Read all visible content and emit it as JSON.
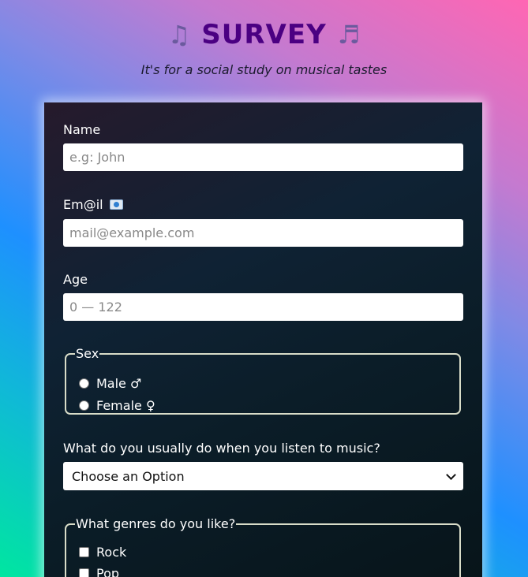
{
  "header": {
    "title": "SURVEY",
    "note_left": "♫",
    "note_right": "♬",
    "subtitle": "It's for a social study on musical tastes"
  },
  "form": {
    "name": {
      "label": "Name",
      "placeholder": "e.g: John"
    },
    "email": {
      "label": "Em@il",
      "icon": "mail-icon",
      "placeholder": "mail@example.com"
    },
    "age": {
      "label": "Age",
      "placeholder": "0 — 122"
    },
    "sex": {
      "legend": "Sex",
      "options": [
        "Male ♂",
        "Female ♀"
      ]
    },
    "activity": {
      "label": "What do you usually do when you listen to music?",
      "selected": "Choose an Option"
    },
    "genres": {
      "legend": "What genres do you like?",
      "options": [
        "Rock",
        "Pop"
      ]
    }
  },
  "colors": {
    "title": "#4b0082",
    "panel": "#0f2234",
    "field_border": "#d8dcc8"
  }
}
